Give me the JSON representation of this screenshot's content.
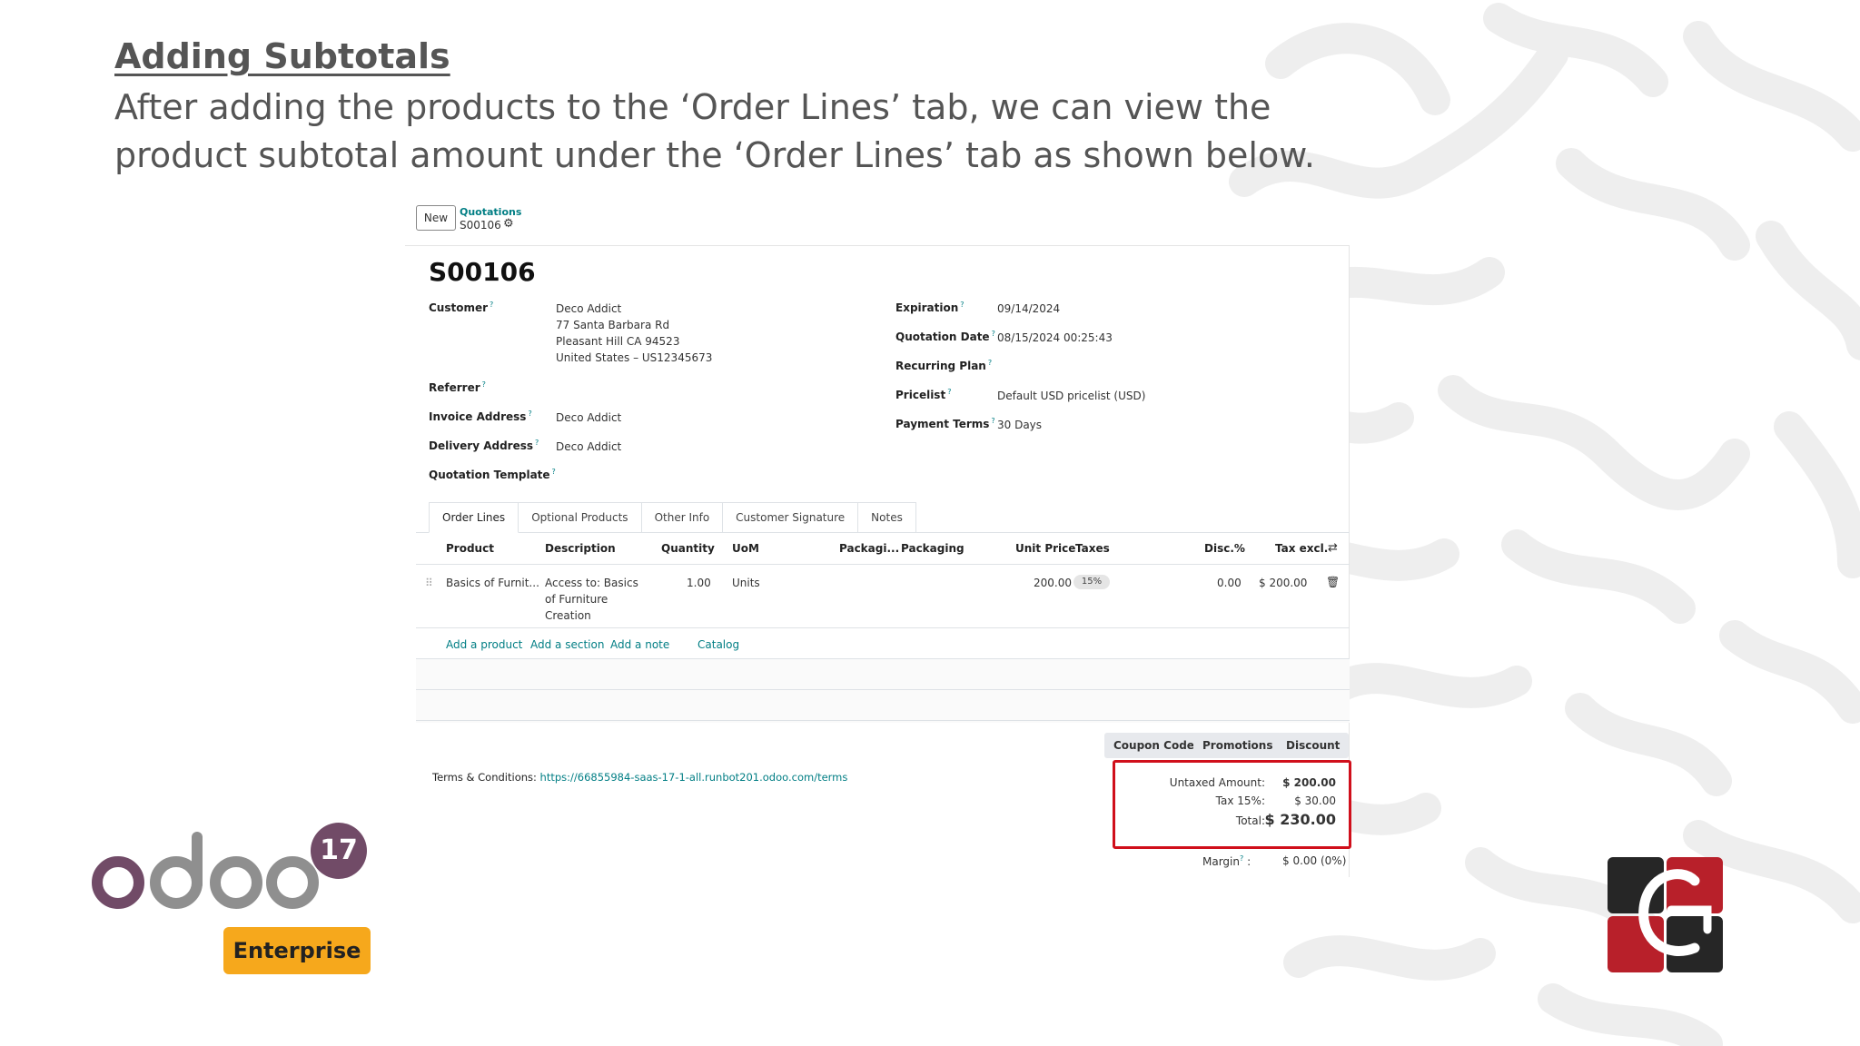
{
  "slide": {
    "title": "Adding Subtotals",
    "description": "After adding the products to the ‘Order Lines’ tab, we can view the product subtotal amount under the ‘Order Lines’ tab as shown below."
  },
  "control_panel": {
    "new_label": "New",
    "breadcrumb_parent": "Quotations",
    "breadcrumb_current": "S00106"
  },
  "record": {
    "name": "S00106",
    "customer_label": "Customer",
    "customer_lines": [
      "Deco Addict",
      "77 Santa Barbara Rd",
      "Pleasant Hill CA 94523",
      "United States – US12345673"
    ],
    "referrer_label": "Referrer",
    "invoice_address_label": "Invoice Address",
    "invoice_address": "Deco Addict",
    "delivery_address_label": "Delivery Address",
    "delivery_address": "Deco Addict",
    "quotation_template_label": "Quotation Template",
    "expiration_label": "Expiration",
    "expiration": "09/14/2024",
    "quotation_date_label": "Quotation Date",
    "quotation_date": "08/15/2024 00:25:43",
    "recurring_plan_label": "Recurring Plan",
    "pricelist_label": "Pricelist",
    "pricelist": "Default USD pricelist (USD)",
    "payment_terms_label": "Payment Terms",
    "payment_terms": "30 Days",
    "help_marker": "?"
  },
  "tabs": [
    "Order Lines",
    "Optional Products",
    "Other Info",
    "Customer Signature",
    "Notes"
  ],
  "table": {
    "headers": [
      "Product",
      "Description",
      "Quantity",
      "UoM",
      "Packagi...",
      "Packaging",
      "Unit Price",
      "Taxes",
      "Disc.%",
      "Tax excl."
    ],
    "rows": [
      {
        "product": "Basics of Furnit...",
        "description_lines": [
          "Access to: Basics",
          "of Furniture",
          "Creation"
        ],
        "quantity": "1.00",
        "uom": "Units",
        "unit_price": "200.00",
        "tax": "15%",
        "discount": "0.00",
        "subtotal": "$ 200.00"
      }
    ],
    "links": [
      "Add a product",
      "Add a section",
      "Add a note",
      "Catalog"
    ]
  },
  "buttons": [
    "Coupon Code",
    "Promotions",
    "Discount"
  ],
  "terms": {
    "label": "Terms & Conditions:",
    "url": "https://66855984-saas-17-1-all.runbot201.odoo.com/terms"
  },
  "totals": {
    "untaxed_label": "Untaxed Amount:",
    "untaxed": "$ 200.00",
    "tax_label": "Tax 15%:",
    "tax": "$ 30.00",
    "total_label": "Total:",
    "total": "$ 230.00",
    "margin_label": "Margin",
    "margin_suffix": ":",
    "margin": "$ 0.00 (0%)"
  },
  "branding": {
    "odoo_version": "17",
    "edition": "Enterprise",
    "odoo_purple": "#714b67",
    "odoo_grey": "#8f8f8f",
    "edition_color": "#f6a81c",
    "highlight_red": "#d00f1b",
    "link_teal": "#017e84"
  }
}
